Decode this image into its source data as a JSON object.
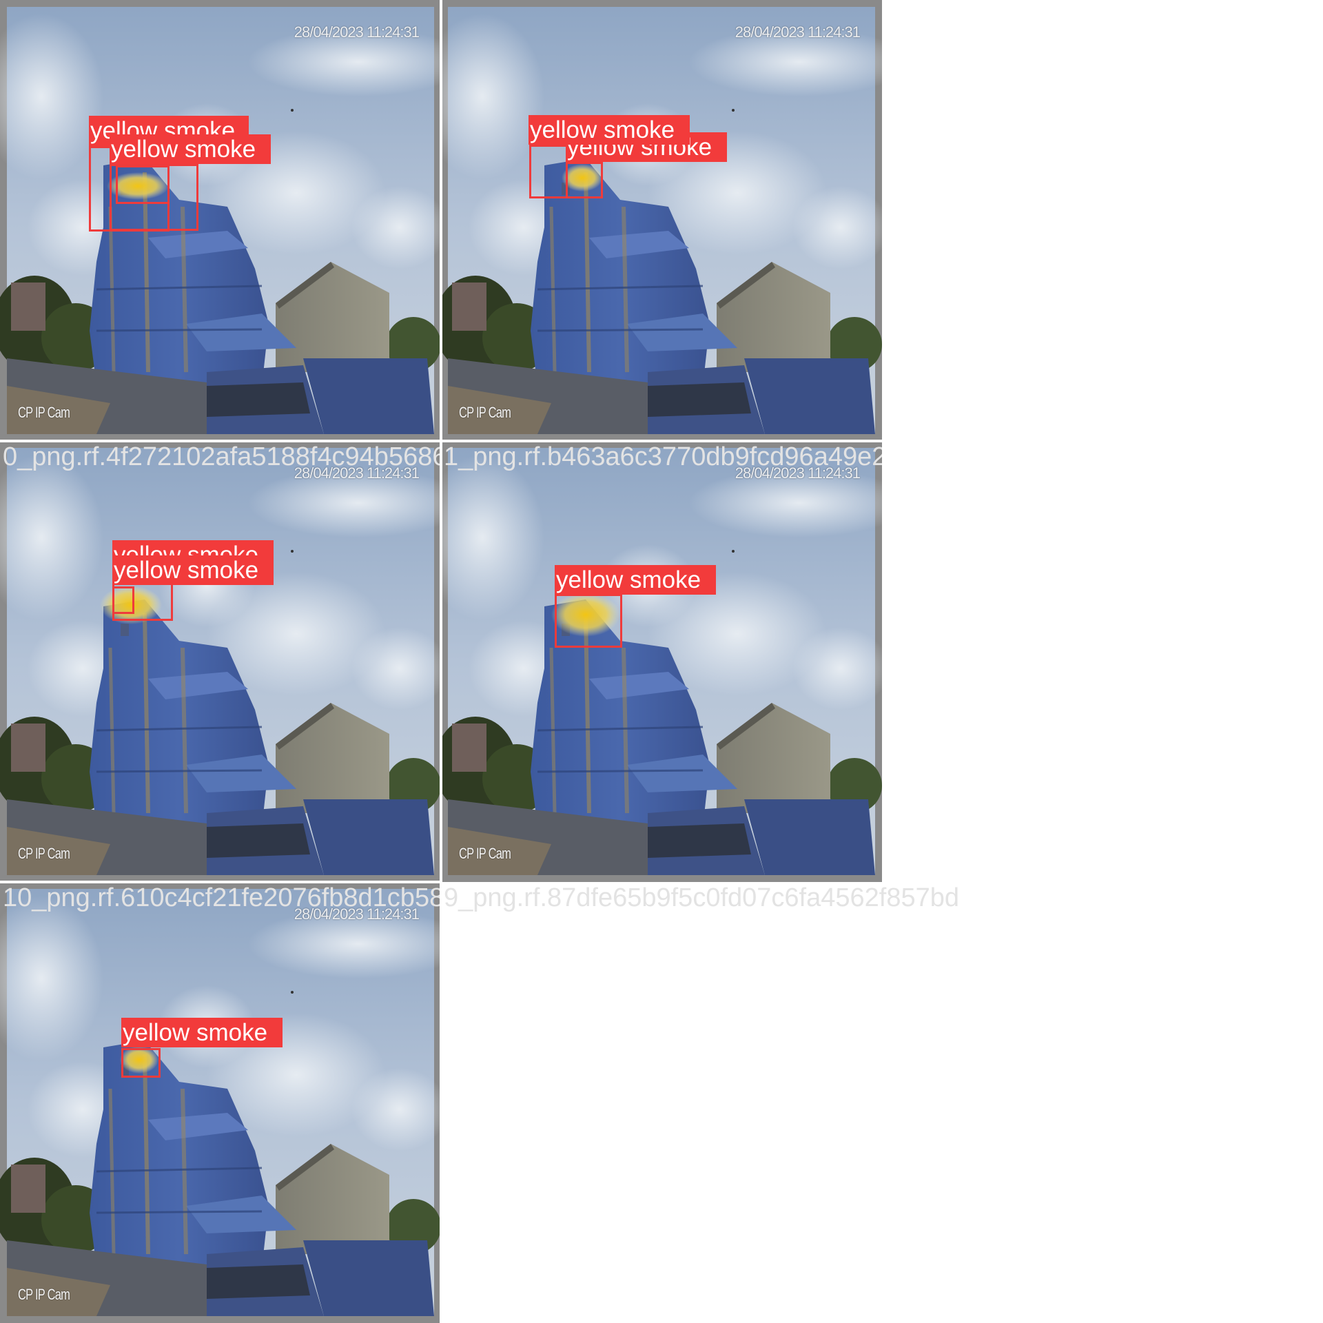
{
  "tiles": [
    {
      "filename": "",
      "timestamp": "28/04/2023 11:24:31",
      "camera_label": "CP IP Cam",
      "smoke_level": "medium",
      "detections": [
        {
          "label": "yellow smoke",
          "color": "#f23b3b"
        },
        {
          "label": "yellow smoke",
          "color": "#f23b3b"
        }
      ]
    },
    {
      "filename": "",
      "timestamp": "28/04/2023 11:24:31",
      "camera_label": "CP IP Cam",
      "smoke_level": "medium",
      "detections": [
        {
          "label": "yellow smoke",
          "color": "#f23b3b"
        },
        {
          "label": "yellow smoke",
          "color": "#f23b3b"
        }
      ]
    },
    {
      "filename": "0_png.rf.4f272102afa5188f4c94b568616b2093",
      "timestamp": "28/04/2023 11:24:31",
      "camera_label": "CP IP Cam",
      "smoke_level": "medium",
      "detections": [
        {
          "label": "yellow smoke",
          "color": "#f23b3b"
        },
        {
          "label": "yellow smoke",
          "color": "#f23b3b"
        }
      ]
    },
    {
      "filename": "1_png.rf.b463a6c3770db9fcd96a49e20cbf01",
      "timestamp": "28/04/2023 11:24:31",
      "camera_label": "CP IP Cam",
      "smoke_level": "heavy",
      "detections": [
        {
          "label": "yellow smoke",
          "color": "#f23b3b"
        }
      ]
    },
    {
      "filename": "10_png.rf.610c4cf21fe2076fb8d1cb5879e633",
      "timestamp": "28/04/2023 11:24:31",
      "camera_label": "CP IP Cam",
      "smoke_level": "light",
      "detections": [
        {
          "label": "yellow smoke",
          "color": "#f23b3b"
        }
      ]
    },
    {
      "filename": "9_png.rf.87dfe65b9f5c0fd07c6fa4562f857bd",
      "timestamp": "",
      "camera_label": "",
      "smoke_level": "",
      "detections": []
    }
  ],
  "colors": {
    "box_red": "#ef3b3b",
    "label_bg": "#f23b3b",
    "filename_text": "#e3e3e3",
    "frame_gray": "#8a8a8a",
    "building_blue": "#4a66a8",
    "smoke_yellow": "#e9c83a"
  }
}
